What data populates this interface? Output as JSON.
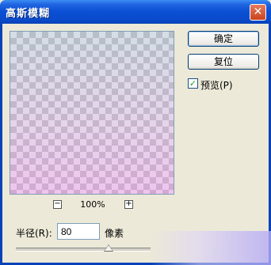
{
  "window": {
    "title": "高斯模糊",
    "close_symbol": "✕"
  },
  "preview": {
    "zoom_out_symbol": "−",
    "zoom_in_symbol": "+",
    "zoom_level": "100%"
  },
  "buttons": {
    "ok_label": "确定",
    "reset_label": "复位"
  },
  "preview_option": {
    "label": "预览(P)",
    "checked": true,
    "check_symbol": "✓"
  },
  "radius": {
    "label": "半径(R):",
    "value": "80",
    "unit": "像素"
  },
  "colors": {
    "title_bar": "#0a4fd4",
    "dialog_bg": "#ece9d8",
    "check_color": "#21a121"
  }
}
